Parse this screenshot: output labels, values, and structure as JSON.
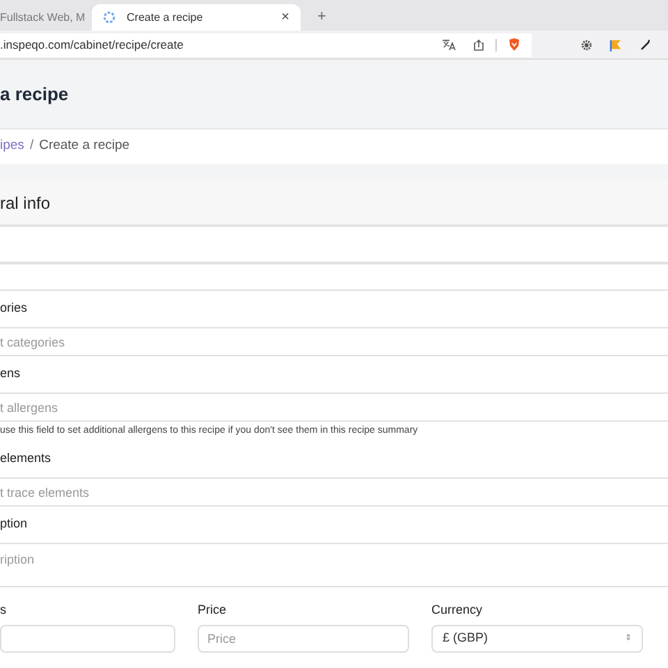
{
  "browser": {
    "tabs": [
      {
        "title": "Fullstack Web, M",
        "selected": false
      },
      {
        "title": "Create a recipe",
        "selected": true
      }
    ],
    "close": "×",
    "new_tab": "+",
    "url": ".inspeqo.com/cabinet/recipe/create"
  },
  "page_title": "a recipe",
  "breadcrumb": {
    "link": "ipes",
    "separator": "/",
    "current": "Create a recipe"
  },
  "section_title": "ral info",
  "fields": [
    {
      "kind": "input"
    },
    {
      "kind": "input"
    },
    {
      "kind": "input",
      "label": "ories",
      "placeholder": "t categories"
    },
    {
      "kind": "input",
      "label": "ens",
      "placeholder": "t allergens",
      "help": "use this field to set additional allergens to this recipe if you don't see them in this recipe summary"
    },
    {
      "kind": "input",
      "label": "elements",
      "placeholder": "t trace elements"
    },
    {
      "kind": "textarea",
      "label": "ption",
      "placeholder": "ription"
    }
  ],
  "price_row": [
    {
      "kind": "input",
      "label": "s"
    },
    {
      "kind": "input",
      "label": "Price",
      "placeholder": "Price"
    },
    {
      "kind": "select",
      "label": "Currency",
      "value": "£ (GBP)",
      "arrow": "⇕"
    }
  ]
}
